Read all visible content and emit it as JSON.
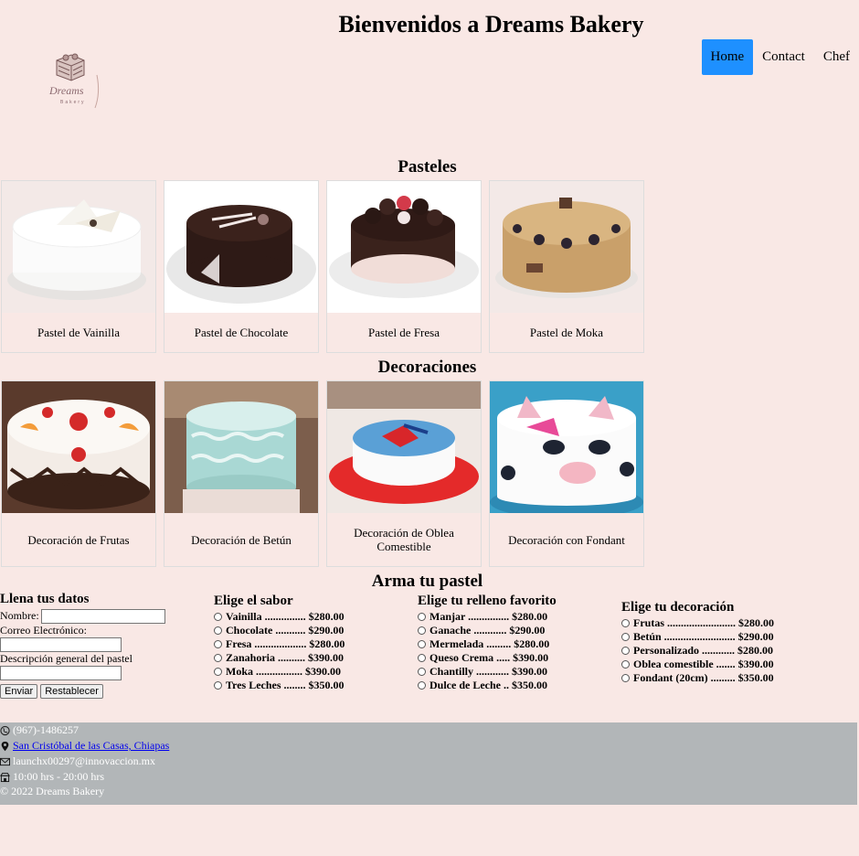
{
  "header": {
    "title": "Bienvenidos a Dreams Bakery",
    "logo_text": "Dreams",
    "logo_sub": "Bakery"
  },
  "nav": [
    {
      "label": "Home",
      "active": true
    },
    {
      "label": "Contact",
      "active": false
    },
    {
      "label": "Chef",
      "active": false
    }
  ],
  "pasteles": {
    "title": "Pasteles",
    "items": [
      {
        "caption": "Pastel de Vainilla"
      },
      {
        "caption": "Pastel de Chocolate"
      },
      {
        "caption": "Pastel de Fresa"
      },
      {
        "caption": "Pastel de Moka"
      }
    ]
  },
  "decoraciones": {
    "title": "Decoraciones",
    "items": [
      {
        "caption": "Decoración de Frutas"
      },
      {
        "caption": "Decoración de Betún"
      },
      {
        "caption": "Decoración de Oblea Comestible"
      },
      {
        "caption": "Decoración con Fondant"
      }
    ]
  },
  "builder": {
    "title": "Arma tu pastel",
    "datos": {
      "title": "Llena tus datos",
      "nombre_label": "Nombre:",
      "correo_label": "Correo Electrónico:",
      "descripcion_label": "Descripción general del pastel",
      "nombre_value": "",
      "correo_value": "",
      "descripcion_value": "",
      "enviar": "Enviar",
      "restablecer": "Restablecer"
    },
    "sabor": {
      "title": "Elige el sabor",
      "options": [
        "Vainilla ............... $280.00",
        "Chocolate ........... $290.00",
        "Fresa ................... $280.00",
        "Zanahoria .......... $390.00",
        "Moka ................. $390.00",
        "Tres Leches ........ $350.00"
      ]
    },
    "relleno": {
      "title": "Elige tu relleno favorito",
      "options": [
        "Manjar ............... $280.00",
        "Ganache ............ $290.00",
        "Mermelada ......... $280.00",
        "Queso Crema ..... $390.00",
        "Chantilly ............ $390.00",
        "Dulce de Leche .. $350.00"
      ]
    },
    "decoracion": {
      "title": "Elige tu decoración",
      "options": [
        "Frutas ......................... $280.00",
        "Betún .......................... $290.00",
        "Personalizado ............ $280.00",
        "Oblea comestible ....... $390.00",
        "Fondant (20cm) ......... $350.00"
      ]
    }
  },
  "footer": {
    "phone": "(967)-1486257",
    "address": "San Cristóbal de las Casas, Chiapas",
    "email": "launchx00297@innovaccion.mx",
    "hours": "10:00 hrs - 20:00 hrs",
    "copyright": "© 2022 Dreams Bakery"
  }
}
